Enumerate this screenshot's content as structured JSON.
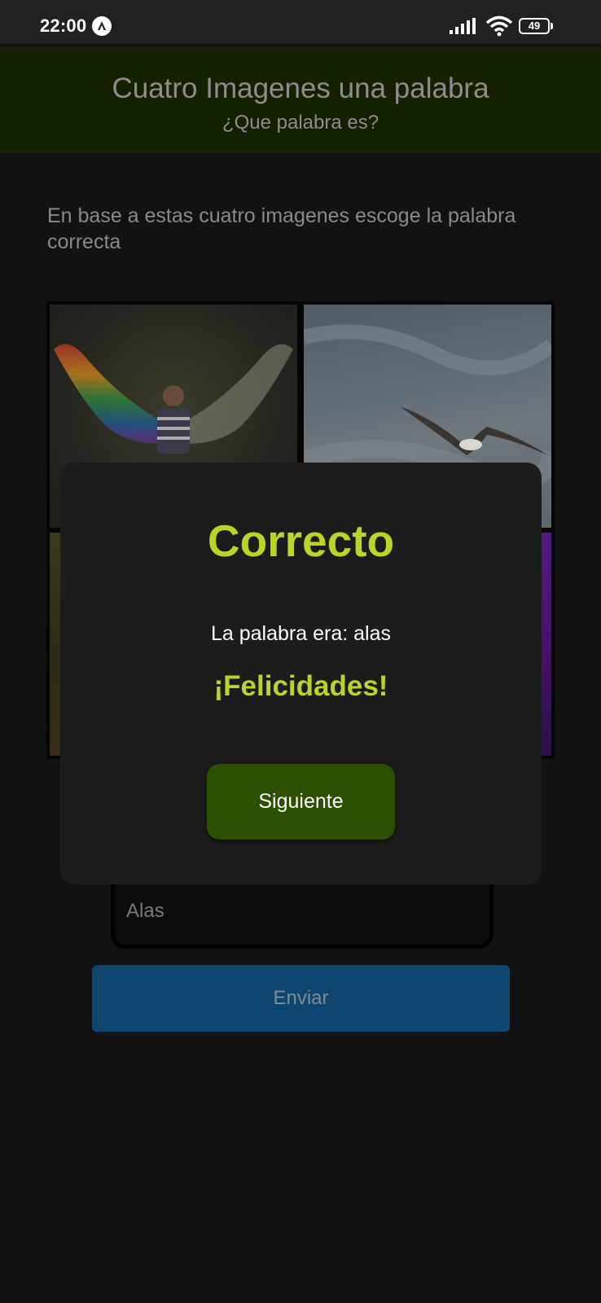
{
  "status_bar": {
    "time": "22:00",
    "app_icon": "a-icon",
    "signal_icon": "signal-icon",
    "wifi_icon": "wifi-icon",
    "battery_level": "49"
  },
  "header": {
    "title": "Cuatro Imagenes una palabra",
    "subtitle": "¿Que palabra es?",
    "background_color": "#142100"
  },
  "instructions": "En base a estas cuatro imagenes escoge la palabra correcta",
  "images": [
    {
      "icon": "neon-rainbow-wings-image"
    },
    {
      "icon": "seagull-in-sky-image"
    },
    {
      "icon": "wings-image"
    },
    {
      "icon": "purple-wings-image"
    }
  ],
  "answer": {
    "value": "Alas"
  },
  "send_button": {
    "label": "Enviar",
    "color": "#0e4670"
  },
  "modal": {
    "title": "Correcto",
    "message": "La palabra era: alas",
    "congrats": "¡Felicidades!",
    "next_label": "Siguiente",
    "accent_color": "#bcd327",
    "button_color": "#2d4f00"
  }
}
